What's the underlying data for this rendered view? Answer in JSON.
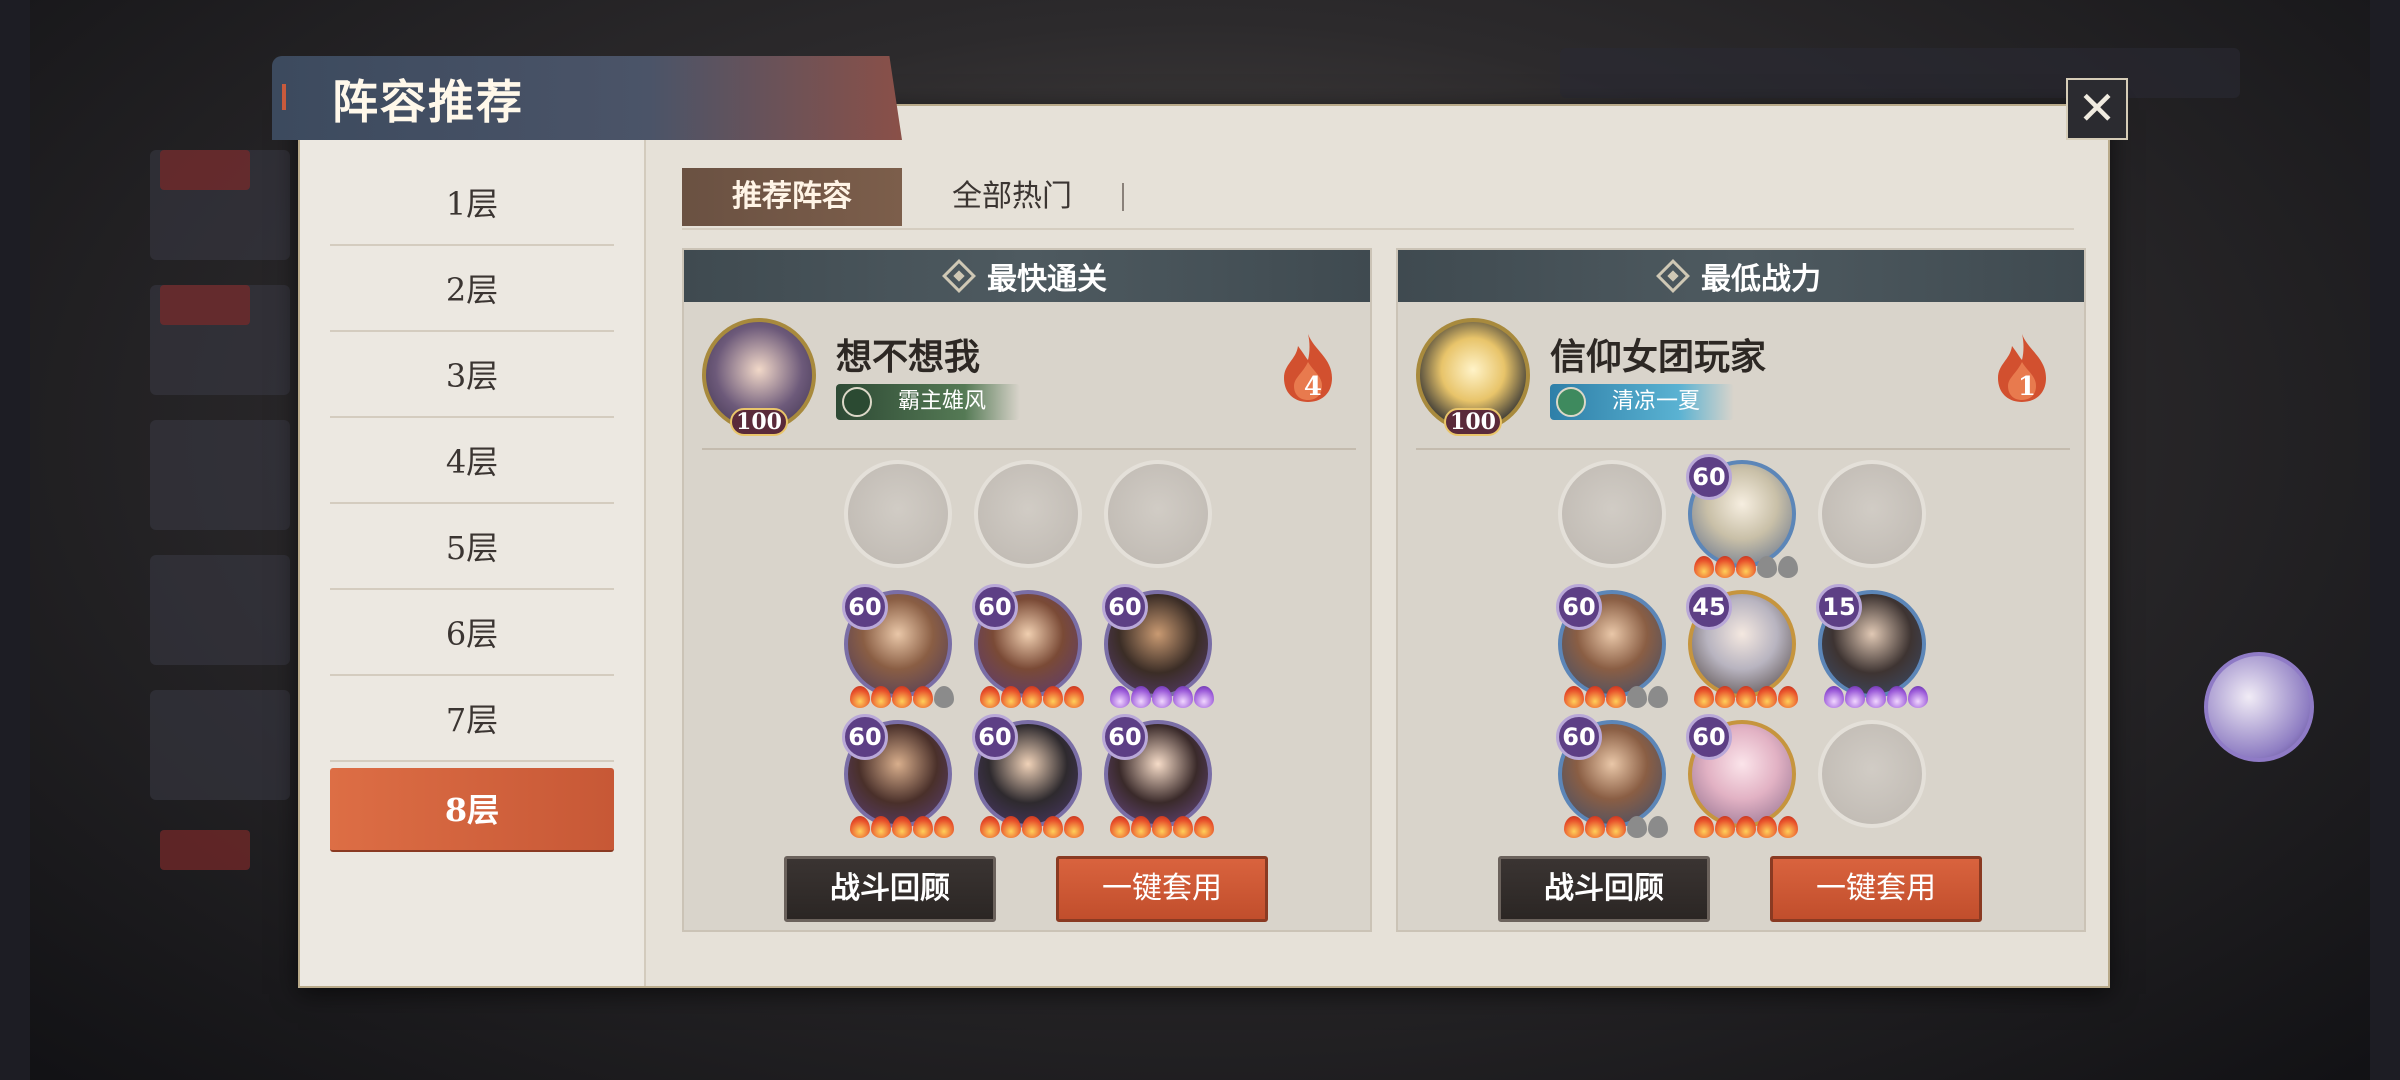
{
  "header": {
    "title": "阵容推荐",
    "close_icon": "close-icon"
  },
  "floors": [
    {
      "label": "1层",
      "active": false
    },
    {
      "label": "2层",
      "active": false
    },
    {
      "label": "3层",
      "active": false
    },
    {
      "label": "4层",
      "active": false
    },
    {
      "label": "5层",
      "active": false
    },
    {
      "label": "6层",
      "active": false
    },
    {
      "label": "7层",
      "active": false
    },
    {
      "label": "8层",
      "active": true
    }
  ],
  "tabs": [
    {
      "label": "推荐阵容",
      "active": true
    },
    {
      "label": "全部热门",
      "active": false
    }
  ],
  "cards": [
    {
      "heading": "最快通关",
      "player": {
        "name": "想不想我",
        "level": "100",
        "title": "霸主雄风",
        "count": "4"
      },
      "slots": [
        {
          "type": "empty"
        },
        {
          "type": "empty"
        },
        {
          "type": "empty"
        },
        {
          "type": "hero",
          "level": "60",
          "stars": [
            "on",
            "on",
            "on",
            "on",
            "off"
          ]
        },
        {
          "type": "hero",
          "level": "60",
          "stars": [
            "on",
            "on",
            "on",
            "on",
            "on"
          ]
        },
        {
          "type": "hero",
          "level": "60",
          "stars": [
            "purple",
            "purple",
            "purple",
            "purple",
            "purple"
          ]
        },
        {
          "type": "hero",
          "level": "60",
          "stars": [
            "on",
            "on",
            "on",
            "on",
            "on"
          ]
        },
        {
          "type": "hero",
          "level": "60",
          "stars": [
            "on",
            "on",
            "on",
            "on",
            "on"
          ]
        },
        {
          "type": "hero",
          "level": "60",
          "stars": [
            "on",
            "on",
            "on",
            "on",
            "on"
          ]
        }
      ],
      "buttons": {
        "review": "战斗回顾",
        "apply": "一键套用"
      }
    },
    {
      "heading": "最低战力",
      "player": {
        "name": "信仰女团玩家",
        "level": "100",
        "title": "清凉一夏",
        "count": "1"
      },
      "slots": [
        {
          "type": "empty"
        },
        {
          "type": "hero",
          "level": "60",
          "stars": [
            "on",
            "on",
            "on",
            "off",
            "off"
          ]
        },
        {
          "type": "empty"
        },
        {
          "type": "hero",
          "level": "60",
          "stars": [
            "on",
            "on",
            "on",
            "off",
            "off"
          ]
        },
        {
          "type": "hero",
          "level": "45",
          "stars": [
            "on",
            "on",
            "on",
            "on",
            "on"
          ]
        },
        {
          "type": "hero",
          "level": "15",
          "stars": [
            "purple",
            "purple",
            "purple",
            "purple",
            "purple"
          ]
        },
        {
          "type": "hero",
          "level": "60",
          "stars": [
            "on",
            "on",
            "on",
            "off",
            "off"
          ]
        },
        {
          "type": "hero",
          "level": "60",
          "stars": [
            "on",
            "on",
            "on",
            "on",
            "on"
          ]
        },
        {
          "type": "empty"
        }
      ],
      "buttons": {
        "review": "战斗回顾",
        "apply": "一键套用"
      }
    }
  ],
  "colors": {
    "accent_orange": "#d9633e",
    "dark_button": "#2b2624",
    "hero_level_badge": "#5d3f85"
  }
}
